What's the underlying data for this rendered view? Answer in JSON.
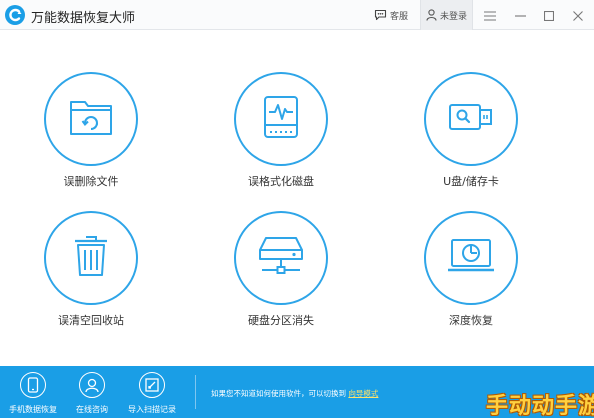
{
  "app": {
    "title": "万能数据恢复大师"
  },
  "titlebar": {
    "feedback_label": "客服",
    "login_label": "未登录"
  },
  "tiles": [
    {
      "label": "误删除文件",
      "icon": "folder-recycle-icon"
    },
    {
      "label": "误格式化磁盘",
      "icon": "disk-wave-icon"
    },
    {
      "label": "U盘/储存卡",
      "icon": "usb-drive-icon"
    },
    {
      "label": "误清空回收站",
      "icon": "recycle-bin-icon"
    },
    {
      "label": "硬盘分区消失",
      "icon": "hard-drive-network-icon"
    },
    {
      "label": "深度恢复",
      "icon": "monitor-scan-icon"
    }
  ],
  "footer": {
    "buttons": [
      {
        "label": "手机数据恢复",
        "icon": "phone-icon"
      },
      {
        "label": "在线咨询",
        "icon": "user-support-icon"
      },
      {
        "label": "导入扫描记录",
        "icon": "import-icon"
      }
    ],
    "hint_text": "如果您不知道如何使用软件，可以切换到",
    "hint_link": "向导模式"
  },
  "watermark": "手动动手游",
  "colors": {
    "accent": "#1a9ee6",
    "icon_stroke": "#2ea5e8",
    "link": "#ffe36a"
  }
}
